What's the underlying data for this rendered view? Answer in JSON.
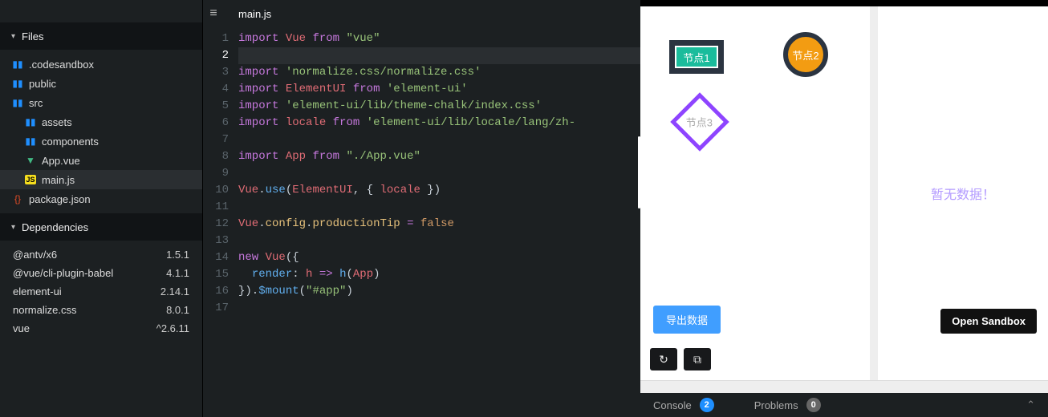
{
  "sidebar": {
    "files_header": "Files",
    "deps_header": "Dependencies",
    "files": [
      {
        "name": ".codesandbox",
        "icon": "folder",
        "indent": 0
      },
      {
        "name": "public",
        "icon": "folder",
        "indent": 0
      },
      {
        "name": "src",
        "icon": "folder",
        "indent": 0
      },
      {
        "name": "assets",
        "icon": "folder",
        "indent": 1
      },
      {
        "name": "components",
        "icon": "folder",
        "indent": 1
      },
      {
        "name": "App.vue",
        "icon": "vue",
        "indent": 1
      },
      {
        "name": "main.js",
        "icon": "js",
        "indent": 1,
        "selected": true
      },
      {
        "name": "package.json",
        "icon": "json",
        "indent": 0
      }
    ],
    "deps": [
      {
        "name": "@antv/x6",
        "version": "1.5.1"
      },
      {
        "name": "@vue/cli-plugin-babel",
        "version": "4.1.1"
      },
      {
        "name": "element-ui",
        "version": "2.14.1"
      },
      {
        "name": "normalize.css",
        "version": "8.0.1"
      },
      {
        "name": "vue",
        "version": "^2.6.11"
      }
    ]
  },
  "editor": {
    "tab": "main.js",
    "active_line": 2,
    "lines": [
      [
        [
          "kw",
          "import"
        ],
        [
          "sp",
          " "
        ],
        [
          "id",
          "Vue"
        ],
        [
          "sp",
          " "
        ],
        [
          "kw",
          "from"
        ],
        [
          "sp",
          " "
        ],
        [
          "str",
          "\"vue\""
        ]
      ],
      [],
      [
        [
          "kw",
          "import"
        ],
        [
          "sp",
          " "
        ],
        [
          "str",
          "'normalize.css/normalize.css'"
        ]
      ],
      [
        [
          "kw",
          "import"
        ],
        [
          "sp",
          " "
        ],
        [
          "id",
          "ElementUI"
        ],
        [
          "sp",
          " "
        ],
        [
          "kw",
          "from"
        ],
        [
          "sp",
          " "
        ],
        [
          "str",
          "'element-ui'"
        ]
      ],
      [
        [
          "kw",
          "import"
        ],
        [
          "sp",
          " "
        ],
        [
          "str",
          "'element-ui/lib/theme-chalk/index.css'"
        ]
      ],
      [
        [
          "kw",
          "import"
        ],
        [
          "sp",
          " "
        ],
        [
          "id",
          "locale"
        ],
        [
          "sp",
          " "
        ],
        [
          "kw",
          "from"
        ],
        [
          "sp",
          " "
        ],
        [
          "str",
          "'element-ui/lib/locale/lang/zh-"
        ]
      ],
      [],
      [
        [
          "kw",
          "import"
        ],
        [
          "sp",
          " "
        ],
        [
          "id",
          "App"
        ],
        [
          "sp",
          " "
        ],
        [
          "kw",
          "from"
        ],
        [
          "sp",
          " "
        ],
        [
          "str",
          "\"./App.vue\""
        ]
      ],
      [],
      [
        [
          "id",
          "Vue"
        ],
        [
          "punc",
          "."
        ],
        [
          "fn",
          "use"
        ],
        [
          "punc",
          "("
        ],
        [
          "id",
          "ElementUI"
        ],
        [
          "punc",
          ", { "
        ],
        [
          "id",
          "locale"
        ],
        [
          "punc",
          " })"
        ]
      ],
      [],
      [
        [
          "id",
          "Vue"
        ],
        [
          "punc",
          "."
        ],
        [
          "prop",
          "config"
        ],
        [
          "punc",
          "."
        ],
        [
          "prop",
          "productionTip"
        ],
        [
          "punc",
          " "
        ],
        [
          "kw",
          "="
        ],
        [
          "punc",
          " "
        ],
        [
          "bool",
          "false"
        ]
      ],
      [],
      [
        [
          "kw",
          "new"
        ],
        [
          "sp",
          " "
        ],
        [
          "id",
          "Vue"
        ],
        [
          "punc",
          "({"
        ]
      ],
      [
        [
          "sp",
          "  "
        ],
        [
          "fn",
          "render"
        ],
        [
          "punc",
          ": "
        ],
        [
          "id",
          "h"
        ],
        [
          "punc",
          " "
        ],
        [
          "arrow",
          "=>"
        ],
        [
          "punc",
          " "
        ],
        [
          "fn",
          "h"
        ],
        [
          "punc",
          "("
        ],
        [
          "id",
          "App"
        ],
        [
          "punc",
          ")"
        ]
      ],
      [
        [
          "punc",
          "})."
        ],
        [
          "fn",
          "$mount"
        ],
        [
          "punc",
          "("
        ],
        [
          "str",
          "\"#app\""
        ],
        [
          "punc",
          ")"
        ]
      ],
      []
    ]
  },
  "preview": {
    "nodes": {
      "rect": "节点1",
      "circle": "节点2",
      "diamond": "节点3"
    },
    "export_label": "导出数据",
    "empty_text": "暂无数据！",
    "open_sandbox": "Open Sandbox",
    "footer": {
      "console_label": "Console",
      "console_count": "2",
      "problems_label": "Problems",
      "problems_count": "0"
    }
  }
}
